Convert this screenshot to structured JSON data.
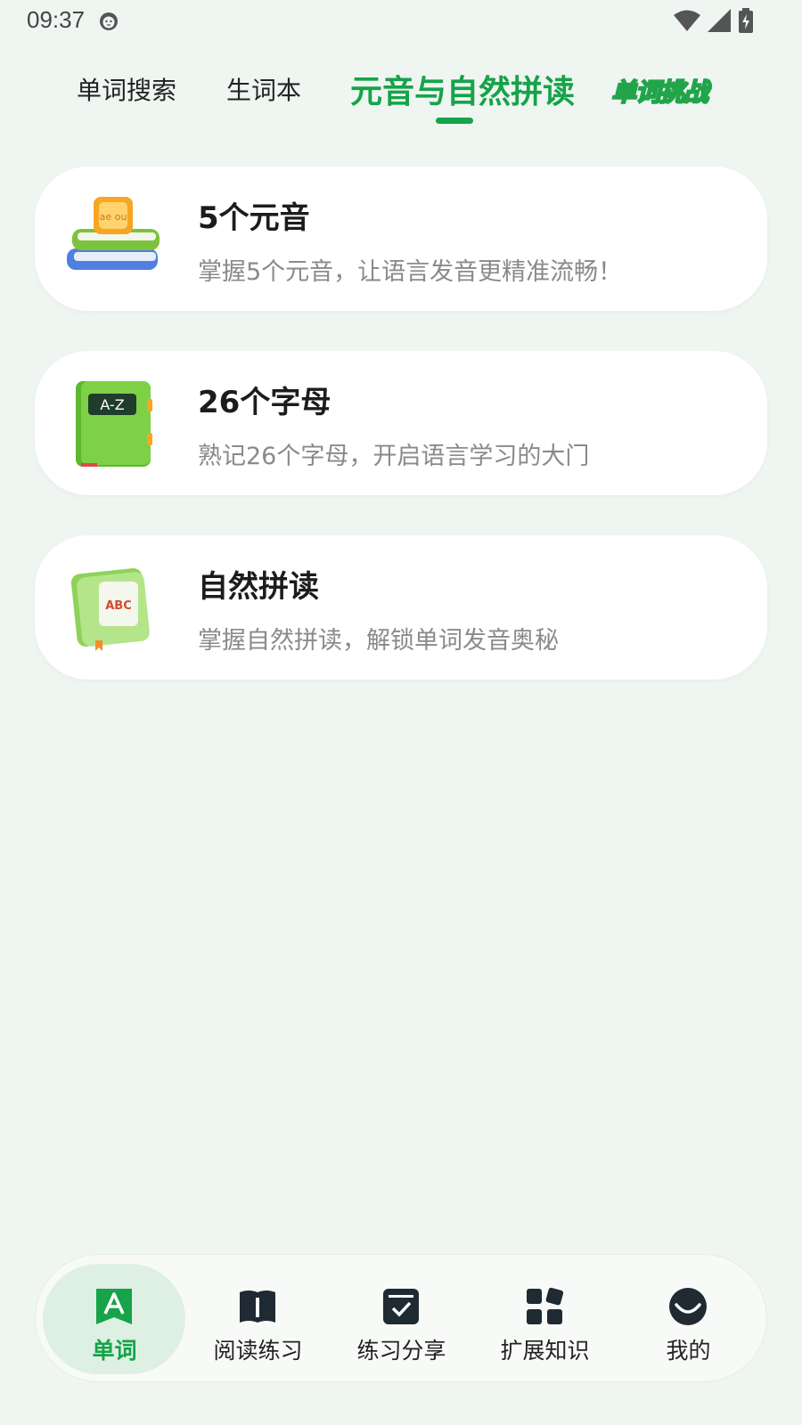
{
  "status_bar": {
    "time": "09:37"
  },
  "tabs": [
    {
      "label": "单词搜索",
      "active": false
    },
    {
      "label": "生词本",
      "active": false
    },
    {
      "label": "元音与自然拼读",
      "active": true
    },
    {
      "label": "单词挑战",
      "active": false
    }
  ],
  "cards": [
    {
      "title": "5个元音",
      "description": "掌握5个元音，让语言发音更精准流畅！",
      "icon": "stacked-books-icon",
      "icon_letters": "ae ou"
    },
    {
      "title": "26个字母",
      "description": "熟记26个字母，开启语言学习的大门",
      "icon": "az-book-icon",
      "icon_letters": "A-Z"
    },
    {
      "title": "自然拼读",
      "description": "掌握自然拼读，解锁单词发音奥秘",
      "icon": "abc-blocks-book-icon",
      "icon_letters": "ABC"
    }
  ],
  "bottom_nav": [
    {
      "label": "单词",
      "icon": "letter-a-icon",
      "active": true
    },
    {
      "label": "阅读练习",
      "icon": "book-open-icon",
      "active": false
    },
    {
      "label": "练习分享",
      "icon": "check-box-icon",
      "active": false
    },
    {
      "label": "扩展知识",
      "icon": "widgets-icon",
      "active": false
    },
    {
      "label": "我的",
      "icon": "smile-icon",
      "active": false
    }
  ],
  "colors": {
    "accent": "#16a34a",
    "background": "#eff6f1",
    "card": "#ffffff",
    "muted_text": "#8a8a8a"
  }
}
